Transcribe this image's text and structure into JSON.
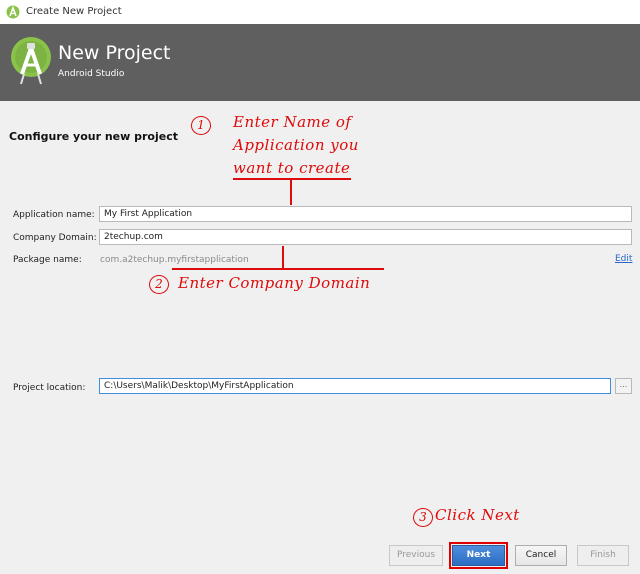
{
  "window": {
    "title": "Create New Project"
  },
  "banner": {
    "heading": "New Project",
    "subheading": "Android Studio"
  },
  "section_title": "Configure your new project",
  "form": {
    "app_name_label": "Application name:",
    "app_name_value": "My First Application",
    "company_label": "Company Domain:",
    "company_value": "2techup.com",
    "package_label": "Package name:",
    "package_value": "com.a2techup.myfirstapplication",
    "edit_link": "Edit",
    "location_label": "Project location:",
    "location_value": "C:\\Users\\Malik\\Desktop\\MyFirstApplication",
    "browse_label": "..."
  },
  "buttons": {
    "previous": "Previous",
    "next": "Next",
    "cancel": "Cancel",
    "finish": "Finish"
  },
  "annotations": {
    "step1_number": "1",
    "step1_line1": "Enter Name of",
    "step1_line2": "Application you",
    "step1_line3": "want to create",
    "step2_number": "2",
    "step2_text": "Enter Company Domain",
    "step3_number": "3",
    "step3_text": "Click Next"
  },
  "colors": {
    "annotation": "#dd0b0b",
    "banner": "#5f5f5f",
    "android_green": "#8bc34a",
    "primary_button": "#2a6dc2"
  }
}
